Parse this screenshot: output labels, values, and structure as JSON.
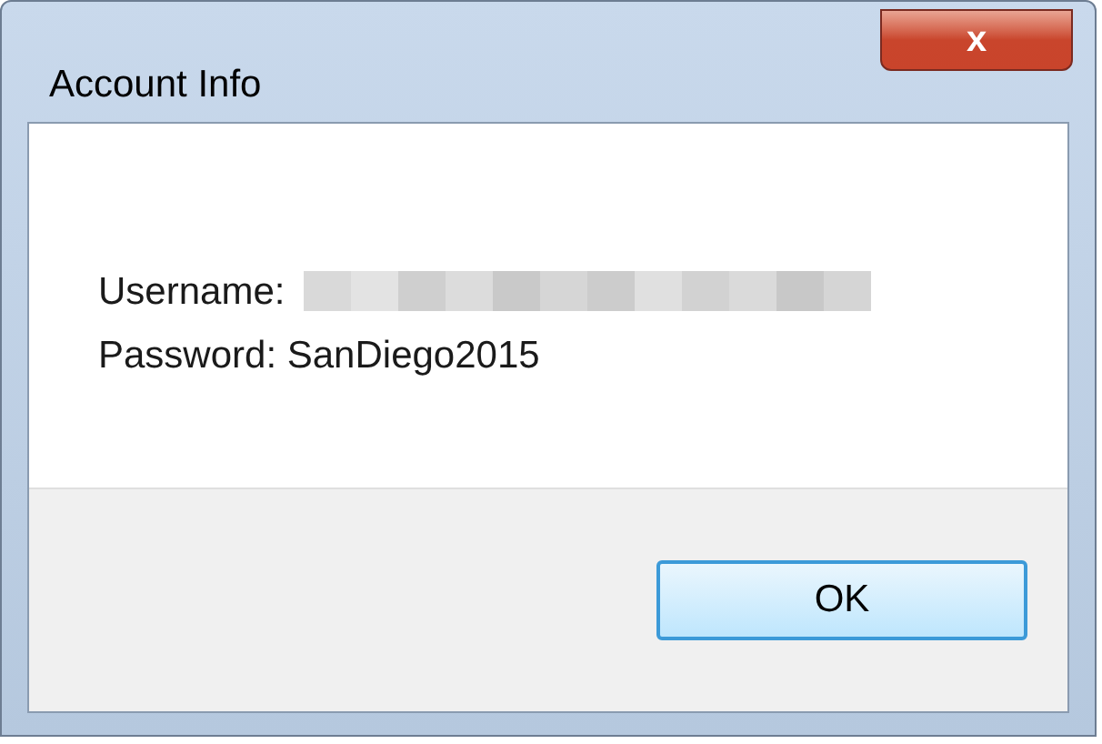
{
  "window": {
    "title": "Account Info",
    "close_label": "x"
  },
  "content": {
    "username_label": "Username:",
    "password_label": "Password: SanDiego2015"
  },
  "buttons": [
    {
      "label": "OK",
      "focused": true
    }
  ]
}
